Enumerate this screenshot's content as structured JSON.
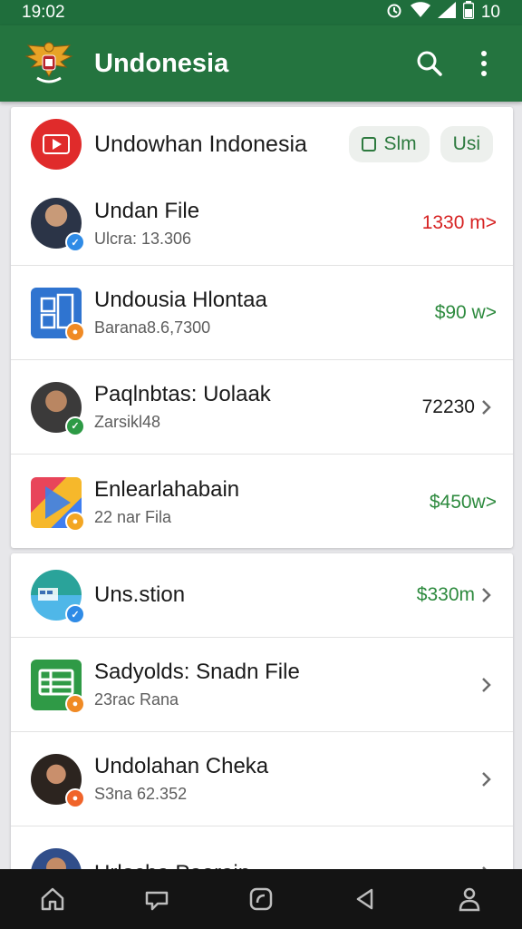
{
  "status_bar": {
    "time": "19:02",
    "battery_label": "10"
  },
  "app_bar": {
    "title": "Undonesia"
  },
  "header": {
    "title": "Undowhan Indonesia",
    "chip1_label": "Slm",
    "chip2_label": "Usi"
  },
  "items1": [
    {
      "title": "Undan File",
      "subtitle": "Ulcra: 13.306",
      "amount": "1330 m>",
      "amount_color": "#d62222"
    },
    {
      "title": "Undousia Hlontaa",
      "subtitle": "Barana8.6,7300",
      "amount": "$90 w>",
      "amount_color": "#2d8a3e"
    },
    {
      "title": "Paqlnbtas: Uolaak",
      "subtitle": "Zarsikl48",
      "amount": "72230",
      "amount_color": "#1a1a1a"
    },
    {
      "title": "Enlearlahabain",
      "subtitle": "22 nar Fila",
      "amount": "$450w>",
      "amount_color": "#2d8a3e"
    }
  ],
  "items2": [
    {
      "title": "Uns.stion",
      "subtitle": "",
      "amount": "$330m",
      "amount_color": "#2d8a3e"
    },
    {
      "title": "Sadyolds: Snadn File",
      "subtitle": "23rac Rana",
      "amount": "",
      "amount_color": "#1a1a1a"
    },
    {
      "title": "Undolahan Cheka",
      "subtitle": "S3na 62.352",
      "amount": "",
      "amount_color": "#1a1a1a"
    },
    {
      "title": "Urlocha Paerain",
      "subtitle": "",
      "amount": "",
      "amount_color": "#1a1a1a"
    }
  ],
  "icons": {
    "status": [
      "alarm-icon",
      "wifi-icon",
      "signal-icon",
      "battery-icon"
    ],
    "app_bar": [
      "garuda-emblem-icon",
      "search-icon",
      "more-vert-icon"
    ],
    "nav": [
      "home-icon",
      "cast-icon",
      "refresh-icon",
      "back-icon",
      "profile-icon"
    ]
  },
  "colors": {
    "primary": "#24743f",
    "status_bar": "#1f6e3c",
    "positive": "#2d8a3e",
    "negative": "#d62222",
    "nav_bar": "#141414"
  }
}
